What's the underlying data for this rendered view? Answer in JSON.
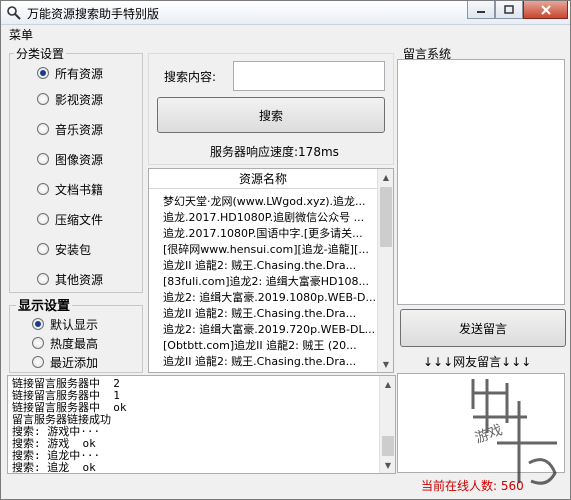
{
  "window": {
    "title": "万能资源搜索助手特别版",
    "icon": "magnifier-icon"
  },
  "menu": {
    "items": [
      "菜单"
    ]
  },
  "category_group": {
    "title": "分类设置",
    "options": [
      {
        "label": "所有资源",
        "checked": true
      },
      {
        "label": "影视资源",
        "checked": false
      },
      {
        "label": "音乐资源",
        "checked": false
      },
      {
        "label": "图像资源",
        "checked": false
      },
      {
        "label": "文档书籍",
        "checked": false
      },
      {
        "label": "压缩文件",
        "checked": false
      },
      {
        "label": "安装包",
        "checked": false
      },
      {
        "label": "其他资源",
        "checked": false
      }
    ]
  },
  "display_group": {
    "title": "显示设置",
    "options": [
      {
        "label": "默认显示",
        "checked": true
      },
      {
        "label": "热度最高",
        "checked": false
      },
      {
        "label": "最近添加",
        "checked": false
      }
    ]
  },
  "search": {
    "label": "搜索内容:",
    "value": "",
    "button": "搜索",
    "speed_text": "服务器响应速度:178ms"
  },
  "results": {
    "header": "资源名称",
    "rows": [
      "梦幻天堂·龙网(www.LWgod.xyz).追龙...",
      "追龙.2017.HD1080P.追剧微信公众号 ...",
      "追龙.2017.1080P.国语中字.[更多请关...",
      "[很碎网www.hensui.com][追龙-追龍][...",
      "追龙II 追龍2: 贼王.Chasing.the.Dra...",
      "[83fuli.com]追龙2: 追缉大富豪HD108...",
      "追龙2: 追缉大富豪.2019.1080p.WEB-D...",
      "追龙II 追龍2: 贼王.Chasing.the.Dra...",
      "追龙2: 追缉大富豪.2019.720p.WEB-DL...",
      "[Obtbtt.com]追龙II 追龍2: 贼王 (20...",
      "追龙II 追龍2: 贼王.Chasing.the.Dra..."
    ]
  },
  "message_system": {
    "title": "留言系统",
    "send_button": "发送留言",
    "friends_label": "↓↓↓网友留言↓↓↓",
    "online_text": "当前在线人数: 560"
  },
  "log": {
    "lines": [
      "链接留言服务器中  2",
      "链接留言服务器中  1",
      "链接留言服务器中  ok",
      "留言服务器链接成功",
      "搜索: 游戏中···",
      "搜索: 游戏  ok",
      "搜索: 追龙中···",
      "搜索: 追龙  ok"
    ]
  },
  "watermark": {
    "text": "游戏"
  },
  "colors": {
    "accent": "#1e3a8a",
    "status_red": "#cc0000"
  }
}
